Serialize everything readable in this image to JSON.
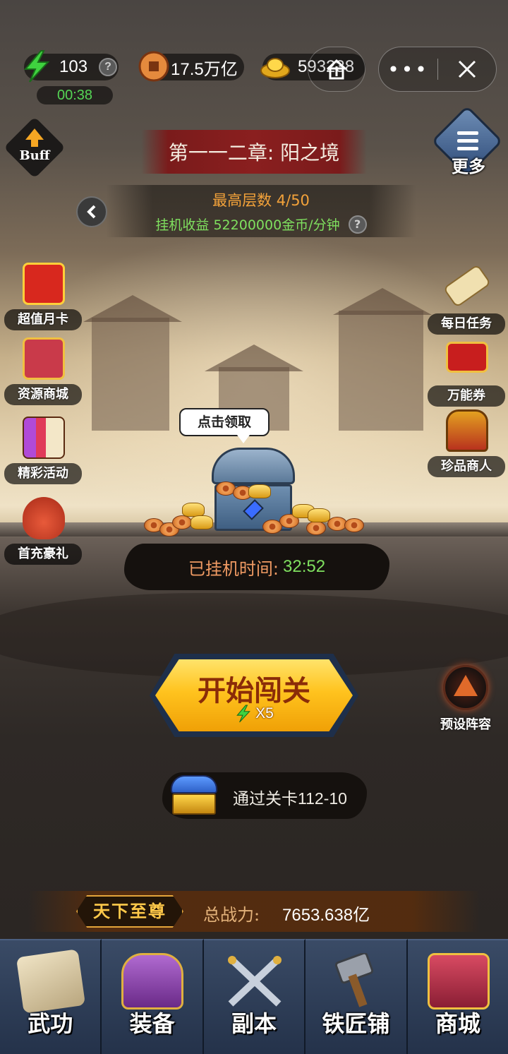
{
  "status_bar": {
    "energy": "103",
    "energy_timer": "00:38",
    "copper": "17.5万亿",
    "gold": "593238",
    "help_glyph": "?"
  },
  "header": {
    "buff_label": "Buff",
    "chapter_title": "第一一二章: 阳之境",
    "more_label": "更多",
    "best_floor": "最高层数 4/50",
    "afk_income": "挂机收益 52200000金币/分钟"
  },
  "left_menu": [
    {
      "label": "超值月卡",
      "icon": "month-card-icon",
      "color": "#d8281e"
    },
    {
      "label": "资源商城",
      "icon": "gift-box-icon",
      "color": "#c93a4a"
    },
    {
      "label": "精彩活动",
      "icon": "books-icon",
      "color": "#b04ad8"
    },
    {
      "label": "首充豪礼",
      "icon": "money-bag-icon",
      "color": "#d94a30"
    }
  ],
  "right_menu": [
    {
      "label": "每日任务",
      "icon": "scroll-icon",
      "color": "#f0e0b0"
    },
    {
      "label": "万能券",
      "icon": "voucher-icon",
      "color": "#c81e1e"
    },
    {
      "label": "珍品商人",
      "icon": "treasure-chest-icon",
      "color": "#e3a020"
    }
  ],
  "chest": {
    "bubble_text": "点击领取",
    "afk_time_label": "已挂机时间:",
    "afk_time_value": "32:52"
  },
  "start_button": {
    "label": "开始闯关",
    "cost": "X5"
  },
  "preset_label": "预设阵容",
  "stage_reward": "通过关卡112-10",
  "power": {
    "rank": "天下至尊",
    "label": "总战力:",
    "value": "7653.638亿"
  },
  "bottom_nav": [
    {
      "label": "武功",
      "icon": "martial-scroll-icon",
      "color": "#d8c9a8"
    },
    {
      "label": "装备",
      "icon": "armor-icon",
      "color": "#8a4aa8"
    },
    {
      "label": "副本",
      "icon": "crossed-swords-icon",
      "color": "#9aa4b4"
    },
    {
      "label": "铁匠铺",
      "icon": "hammer-icon",
      "color": "#8a8e96"
    },
    {
      "label": "商城",
      "icon": "gift-shop-icon",
      "color": "#b8324a"
    }
  ],
  "colors": {
    "energy_green": "#55d655",
    "income_green": "#7fe05f",
    "best_orange": "#f3a23a",
    "button_gold": "#ffc31e"
  }
}
